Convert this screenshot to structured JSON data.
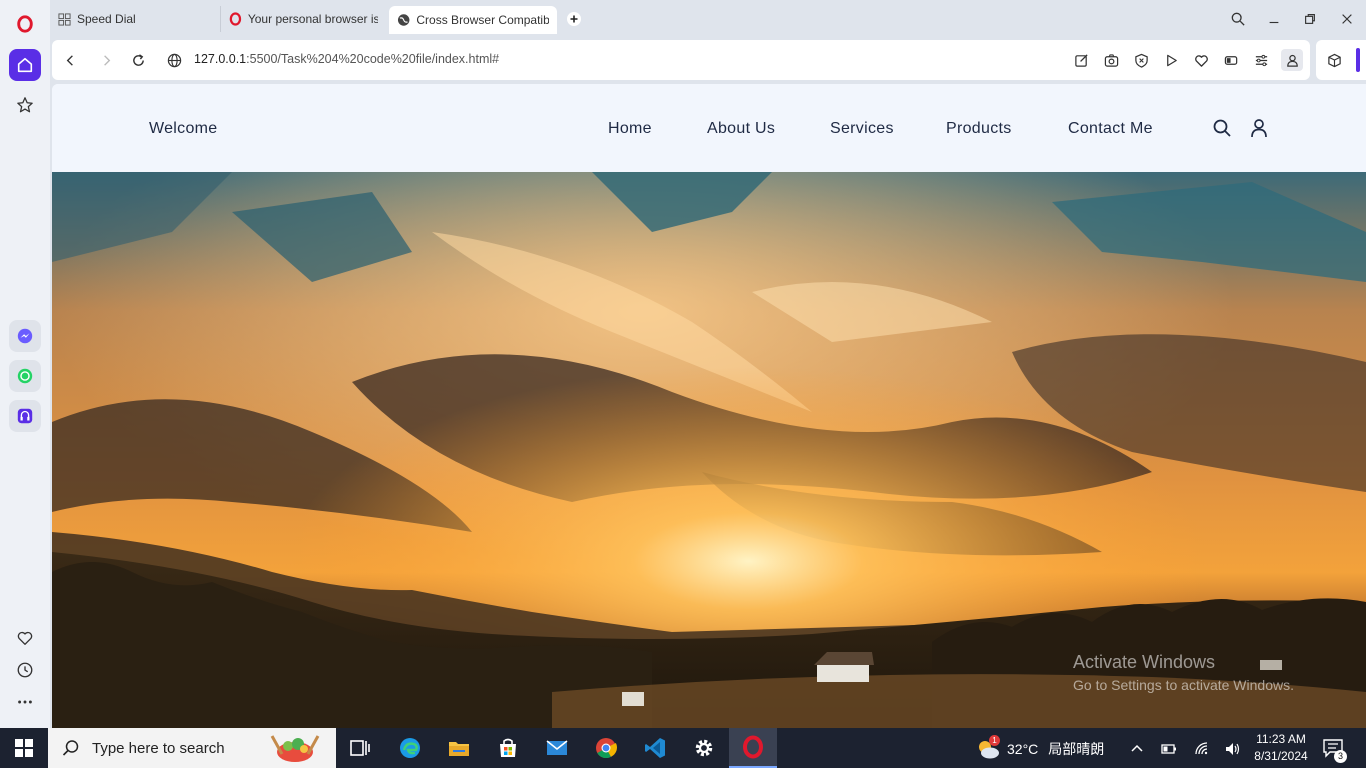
{
  "tabs": [
    {
      "label": "Speed Dial",
      "icon": "speed-dial-icon"
    },
    {
      "label": "Your personal browser is a",
      "icon": "opera-icon"
    },
    {
      "label": "Cross Browser Compatibil",
      "icon": "globe-icon",
      "active": true
    }
  ],
  "address": {
    "host": "127.0.0.1",
    "path": ":5500/Task%204%20code%20file/index.html#"
  },
  "site": {
    "brand": "Welcome",
    "nav": [
      "Home",
      "About Us",
      "Services",
      "Products",
      "Contact Me"
    ]
  },
  "watermark": {
    "line1": "Activate Windows",
    "line2": "Go to Settings to activate Windows."
  },
  "taskbar": {
    "search_placeholder": "Type here to search",
    "weather_temp": "32°C",
    "weather_desc": "局部晴朗",
    "weather_badge": "1",
    "time": "11:23 AM",
    "date": "8/31/2024",
    "notifications": "3"
  },
  "colors": {
    "accent": "#5a2ee6",
    "opera_red": "#e0182d",
    "nav_text": "#1f2a44",
    "page_bg": "#f2f6fd"
  }
}
